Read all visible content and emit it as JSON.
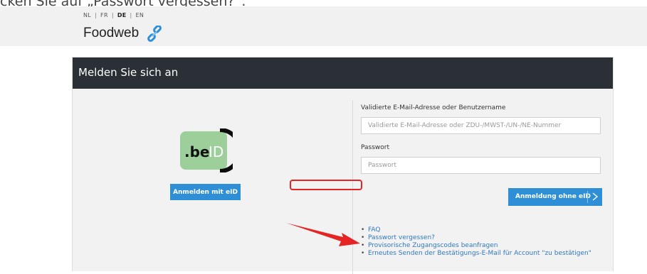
{
  "caption": "cken Sie auf „Passwort vergessen?“.",
  "header": {
    "languages": [
      {
        "code": "NL",
        "active": false
      },
      {
        "code": "FR",
        "active": false
      },
      {
        "code": "DE",
        "active": true
      },
      {
        "code": "EN",
        "active": false
      }
    ],
    "separator": "|",
    "brand_name": "Foodweb",
    "brand_icon": "chain-link-icon"
  },
  "panel": {
    "title": "Melden Sie sich an"
  },
  "eid": {
    "logo_text_be": ".be",
    "logo_text_id": "ID",
    "button_label": "Anmelden mit eID"
  },
  "form": {
    "username_label": "Validierte E-Mail-Adresse oder Benutzername",
    "username_placeholder": "Validierte E-Mail-Adresse oder ZDU-/MWST-/UN-/NE-Nummer",
    "password_label": "Passwort",
    "password_placeholder": "Passwort",
    "login_button_label": "Anmeldung ohne eID"
  },
  "links": [
    "FAQ",
    "Passwort vergessen?",
    "Provisorische Zugangscodes beanfragen",
    "Erneutes Senden der Bestätigungs-E-Mail für Account \"zu bestätigen\""
  ],
  "colors": {
    "header_bg": "#2a3035",
    "button_blue": "#2f8fd6",
    "link_blue": "#2f78c4",
    "annotation_red": "#e52424"
  }
}
